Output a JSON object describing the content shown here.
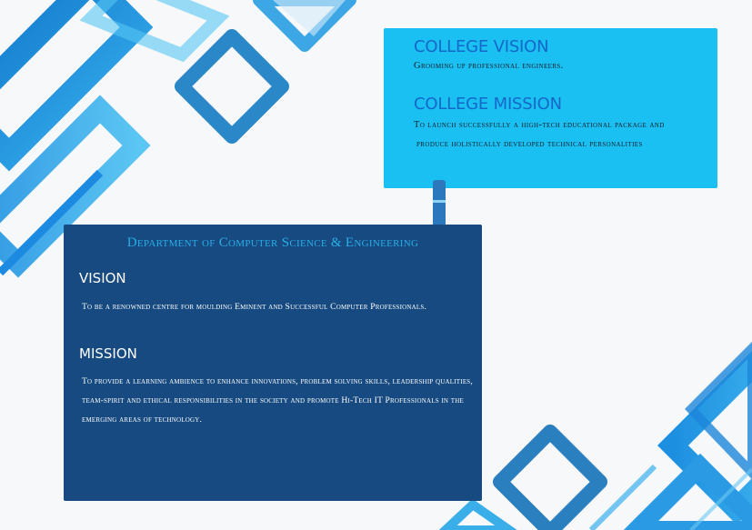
{
  "college": {
    "vision_heading": "COLLEGE VISION",
    "vision_text": "Grooming up professional engineers.",
    "mission_heading": "COLLEGE MISSION",
    "mission_line1": "To launch successfully a high-tech educational package and",
    "mission_line2": "produce holistically developed technical personalities"
  },
  "department": {
    "title": "Department of Computer Science & Engineering",
    "vision_heading": "VISION",
    "vision_text": "To be a renowned centre for moulding Eminent and Successful Computer Professionals.",
    "mission_heading": "MISSION",
    "mission_text": "To provide a learning ambience to enhance innovations, problem solving skills, leadership qualities, team-spirit and ethical responsibilities in the society and promote Hi-Tech IT Professionals in the emerging areas of technology."
  },
  "colors": {
    "college_panel": "#1bc0f2",
    "college_heading": "#1368c9",
    "department_panel": "#164a80",
    "department_title": "#2aaee8",
    "decor_blue": "#2196e8"
  }
}
